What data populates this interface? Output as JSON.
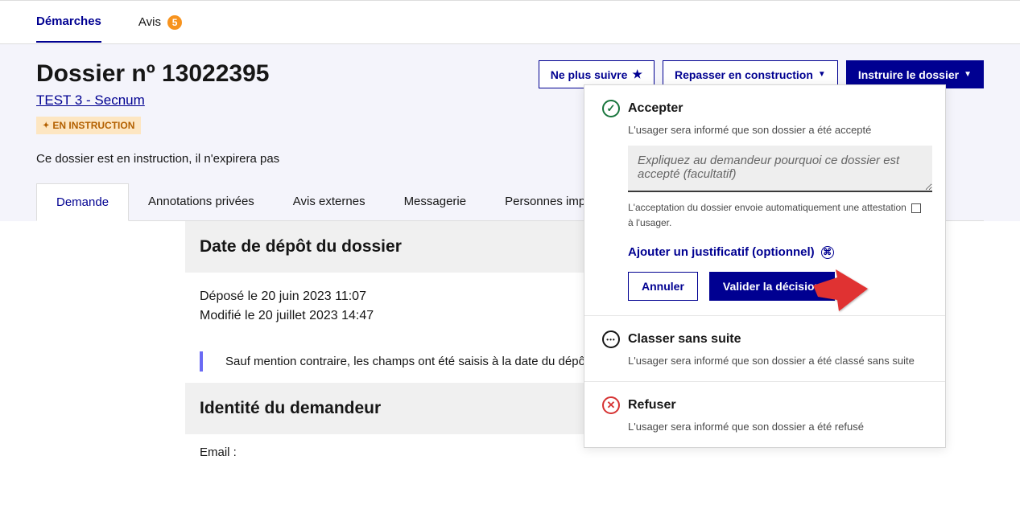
{
  "topnav": {
    "tab1": "Démarches",
    "tab2": "Avis",
    "avis_count": "5"
  },
  "header": {
    "title": "Dossier nº 13022395",
    "procedure_link": "TEST 3 - Secnum",
    "status": "EN INSTRUCTION",
    "expiry_note": "Ce dossier est en instruction, il n'expirera pas"
  },
  "actions": {
    "unfollow": "Ne plus suivre",
    "back_construction": "Repasser en construction",
    "instruct": "Instruire le dossier"
  },
  "tabs": {
    "demande": "Demande",
    "annotations": "Annotations privées",
    "avis": "Avis externes",
    "messagerie": "Messagerie",
    "personnes": "Personnes impliquées"
  },
  "content": {
    "section1_title": "Date de dépôt du dossier",
    "deposited": "Déposé le 20 juin 2023 11:07",
    "modified": "Modifié le 20 juillet 2023 14:47",
    "callout": "Sauf mention contraire, les champs ont été saisis à la date du dépôt",
    "section2_title": "Identité du demandeur",
    "email_label": "Email :"
  },
  "popover": {
    "accept": {
      "title": "Accepter",
      "desc": "L'usager sera informé que son dossier a été accepté",
      "placeholder": "Expliquez au demandeur pourquoi ce dossier est accepté (facultatif)",
      "note_pre": "L'acceptation du dossier envoie automatiquement une attestation",
      "note_post": "à l'usager.",
      "add_justif": "Ajouter un justificatif (optionnel)",
      "cancel": "Annuler",
      "validate": "Valider la décision"
    },
    "dismiss": {
      "title": "Classer sans suite",
      "desc": "L'usager sera informé que son dossier a été classé sans suite"
    },
    "refuse": {
      "title": "Refuser",
      "desc": "L'usager sera informé que son dossier a été refusé"
    }
  }
}
